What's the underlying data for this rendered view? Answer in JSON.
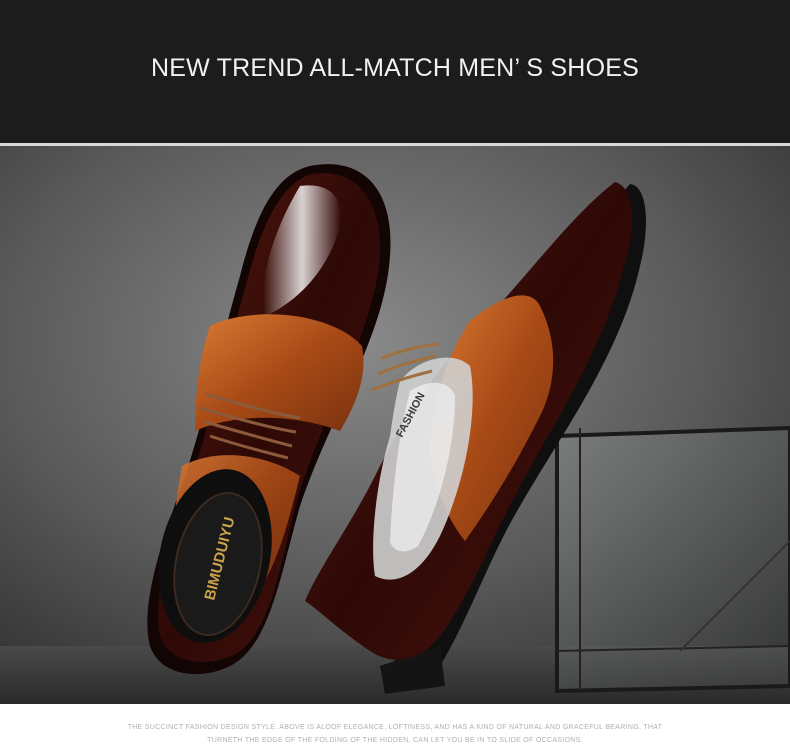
{
  "header": {
    "title": "NEW TREND ALL-MATCH MEN’ S SHOES"
  },
  "photo": {
    "left_shoe_insole_brand": "BIMUDUIYU",
    "right_shoe_side_stamp": "FASHION",
    "colors": {
      "background_dark": "#2a2a2a",
      "background_mid": "#6e6e6e",
      "patent_burgundy": "#3b0d0a",
      "tan_leather": "#b4541c",
      "sole_black": "#111111"
    }
  },
  "caption": {
    "line1": "THE SUCCINCT FASHION DESIGN STYLE. ABOVE IS ALOOF ELEGANCE, LOFTINESS, AND HAS A KIND OF NATURAL AND GRACEFUL BEARING, THAT",
    "line2": "TURNETH THE EDGE OF THE FOLDING OF THE HIDDEN, CAN LET YOU BE IN TO SLIDE OF OCCASIONS."
  }
}
